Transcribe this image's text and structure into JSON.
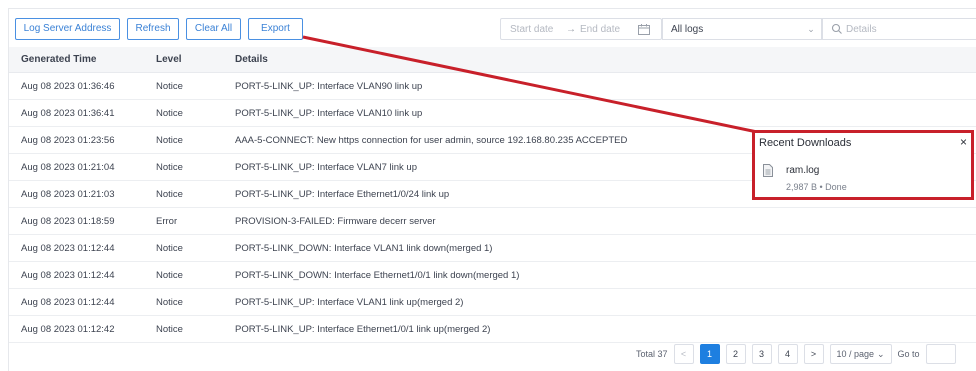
{
  "toolbar": {
    "log_server_label": "Log Server Address",
    "refresh_label": "Refresh",
    "clear_label": "Clear All",
    "export_label": "Export"
  },
  "filters": {
    "start_placeholder": "Start date",
    "arrow": "→",
    "end_placeholder": "End date",
    "log_type_value": "All logs",
    "search_placeholder": "Details"
  },
  "table": {
    "columns": [
      "Generated Time",
      "Level",
      "Details"
    ],
    "rows": [
      {
        "time": "Aug 08 2023 01:36:46",
        "level": "Notice",
        "details": "PORT-5-LINK_UP: Interface VLAN90 link up"
      },
      {
        "time": "Aug 08 2023 01:36:41",
        "level": "Notice",
        "details": "PORT-5-LINK_UP: Interface VLAN10 link up"
      },
      {
        "time": "Aug 08 2023 01:23:56",
        "level": "Notice",
        "details": "AAA-5-CONNECT: New https connection for user admin, source 192.168.80.235 ACCEPTED"
      },
      {
        "time": "Aug 08 2023 01:21:04",
        "level": "Notice",
        "details": "PORT-5-LINK_UP: Interface VLAN7 link up"
      },
      {
        "time": "Aug 08 2023 01:21:03",
        "level": "Notice",
        "details": "PORT-5-LINK_UP: Interface Ethernet1/0/24 link up"
      },
      {
        "time": "Aug 08 2023 01:18:59",
        "level": "Error",
        "details": "PROVISION-3-FAILED: Firmware decerr server"
      },
      {
        "time": "Aug 08 2023 01:12:44",
        "level": "Notice",
        "details": "PORT-5-LINK_DOWN: Interface VLAN1 link down(merged 1)"
      },
      {
        "time": "Aug 08 2023 01:12:44",
        "level": "Notice",
        "details": "PORT-5-LINK_DOWN: Interface Ethernet1/0/1 link down(merged 1)"
      },
      {
        "time": "Aug 08 2023 01:12:44",
        "level": "Notice",
        "details": "PORT-5-LINK_UP: Interface VLAN1 link up(merged 2)"
      },
      {
        "time": "Aug 08 2023 01:12:42",
        "level": "Notice",
        "details": "PORT-5-LINK_UP: Interface Ethernet1/0/1 link up(merged 2)"
      }
    ]
  },
  "pagination": {
    "total": "Total 37",
    "prev": "<",
    "pages": [
      "1",
      "2",
      "3",
      "4"
    ],
    "current_page": "1",
    "next": ">",
    "page_size": "10 / page",
    "goto_label": "Go to"
  },
  "downloads": {
    "title": "Recent Downloads",
    "close": "×",
    "file_name": "ram.log",
    "file_meta": "2,987 B • Done"
  },
  "colors": {
    "accent": "#1e7fe0",
    "annotation": "#c8202a"
  },
  "icons": [
    "calendar-icon",
    "chevron-down-icon",
    "search-icon",
    "file-icon",
    "close-icon"
  ]
}
